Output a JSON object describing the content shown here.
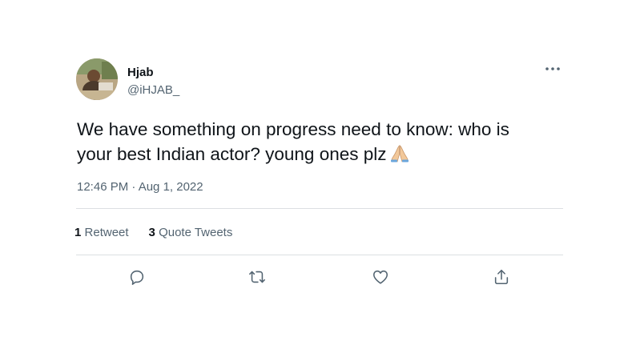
{
  "author": {
    "name": "Hjab",
    "handle": "@iHJAB_"
  },
  "tweet": {
    "text_line1": "We have something on progress need to know: who is",
    "text_line2": "your best Indian actor? young ones plz"
  },
  "meta": {
    "timestamp": "12:46 PM · Aug 1, 2022"
  },
  "stats": {
    "retweets_count": "1",
    "retweets_label": "Retweet",
    "quotes_count": "3",
    "quotes_label": "Quote Tweets"
  },
  "icons": {
    "more": "more-horizontal-icon",
    "reply": "reply-icon",
    "retweet": "retweet-icon",
    "like": "heart-icon",
    "share": "share-icon"
  },
  "colors": {
    "text_primary": "#0f1419",
    "text_secondary": "#536471",
    "divider": "#dcdfe2"
  }
}
